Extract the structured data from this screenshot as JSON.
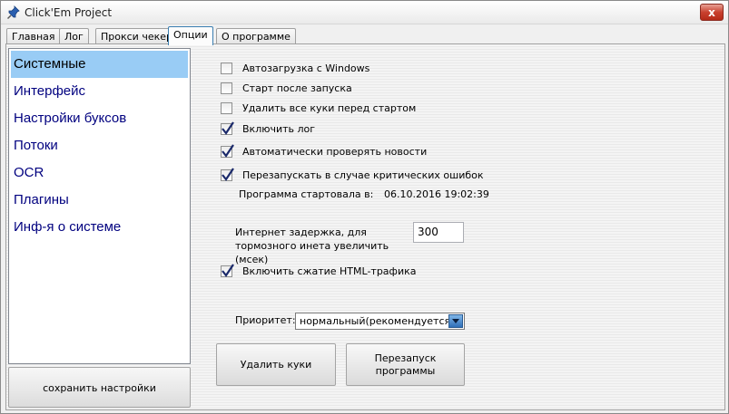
{
  "window": {
    "title": "Click'Em Project",
    "close_label": "x"
  },
  "tabs": [
    {
      "label": "Главная",
      "active": false
    },
    {
      "label": "Лог",
      "active": false
    },
    {
      "label": "Прокси чекер",
      "active": false
    },
    {
      "label": "Опции",
      "active": true
    },
    {
      "label": "О программе",
      "active": false
    }
  ],
  "sidebar": {
    "items": [
      {
        "label": "Системные",
        "selected": true
      },
      {
        "label": "Интерфейс",
        "selected": false
      },
      {
        "label": "Настройки буксов",
        "selected": false
      },
      {
        "label": "Потоки",
        "selected": false
      },
      {
        "label": "OCR",
        "selected": false
      },
      {
        "label": "Плагины",
        "selected": false
      },
      {
        "label": "Инф-я о системе",
        "selected": false
      }
    ],
    "save_label": "сохранить настройки"
  },
  "options": {
    "checkboxes": [
      {
        "label": "Автозагрузка с Windows",
        "checked": false
      },
      {
        "label": "Старт после запуска",
        "checked": false
      },
      {
        "label": "Удалить все куки перед стартом",
        "checked": false
      },
      {
        "label": "Включить лог",
        "checked": true
      },
      {
        "label": "Автоматически проверять новости",
        "checked": true
      },
      {
        "label": "Перезапускать в случае критических ошибок",
        "checked": true
      }
    ],
    "started_label": "Программа стартовала в:",
    "started_value": "06.10.2016  19:02:39",
    "delay_label": "Интернет задержка, для тормозного инета увеличить (мсек)",
    "delay_value": "300",
    "html_compress_label": "Включить сжатие HTML-трафика",
    "html_compress_checked": true,
    "priority_label": "Приоритет:",
    "priority_value": "нормальный(рекомендуется)",
    "delete_cookies_label": "Удалить куки",
    "restart_label": "Перезапуск программы"
  },
  "colors": {
    "selected_bg": "#99ccf5",
    "list_text": "#00007f",
    "close_red": "#c9412f"
  }
}
